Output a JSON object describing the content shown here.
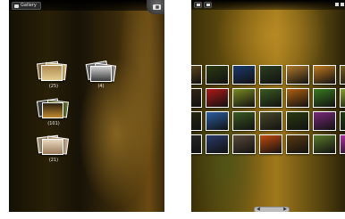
{
  "left_screen": {
    "top_bar": {
      "gallery_label": "Gallery"
    },
    "albums": [
      {
        "count": "(25)"
      },
      {
        "count": "(4)"
      },
      {
        "count": "(101)"
      },
      {
        "count": "(21)"
      }
    ]
  },
  "right_screen": {
    "thumb_colors": [
      [
        "#6a4e1a",
        "#2c3a12",
        "#1b3a6e",
        "#2a3e20",
        "#b0782a",
        "#c07a20",
        "#7a6020",
        "#5a2a10",
        "#4a3010"
      ],
      [
        "#3a2a12",
        "#b01818",
        "#7a8a20",
        "#3a5a20",
        "#b06010",
        "#3a7a20",
        "#8aa030",
        "#3a3a3a",
        "#aa3018"
      ],
      [
        "#2a2a10",
        "#2a60a0",
        "#3a5a20",
        "#4a4a28",
        "#2a3a10",
        "#7a2a7a",
        "#203a10",
        "#4a4a4a",
        "#6a6a6a"
      ],
      [
        "#2a2a2a",
        "#2a3a6a",
        "#5a4a3a",
        "#c04a10",
        "#5a3a10",
        "#5a7a2a",
        "#b030a0",
        "#2a5a3a",
        "#4a4a4a"
      ]
    ]
  }
}
